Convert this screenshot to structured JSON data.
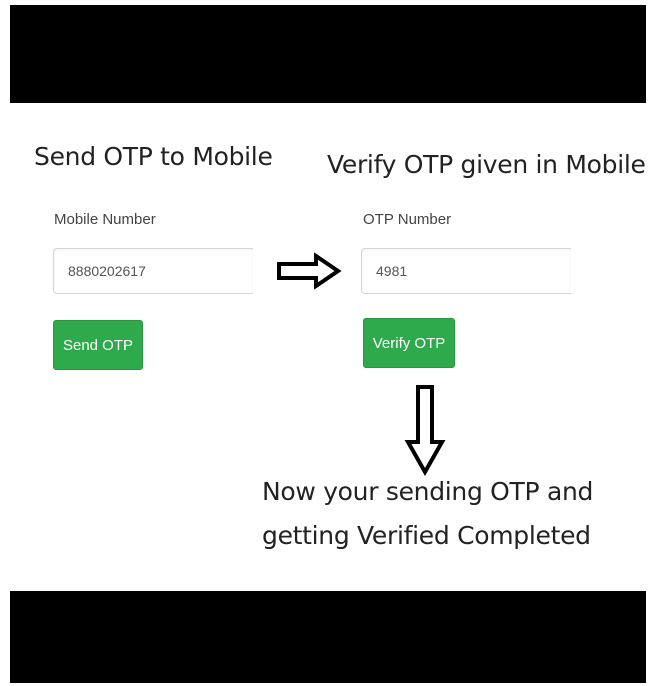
{
  "send_section": {
    "heading": "Send OTP to Mobile",
    "field_label": "Mobile Number",
    "field_value": "8880202617",
    "button_label": "Send OTP"
  },
  "verify_section": {
    "heading": "Verify OTP given in Mobile",
    "field_label": "OTP Number",
    "field_value": "4981",
    "button_label": "Verify OTP"
  },
  "completion_message": {
    "line1": "Now your sending OTP and",
    "line2": "getting Verified Completed"
  },
  "icons": {
    "right_arrow": "arrow-right-icon",
    "down_arrow": "arrow-down-icon"
  },
  "colors": {
    "button_green": "#2ea94b",
    "letterbox": "#000000"
  }
}
